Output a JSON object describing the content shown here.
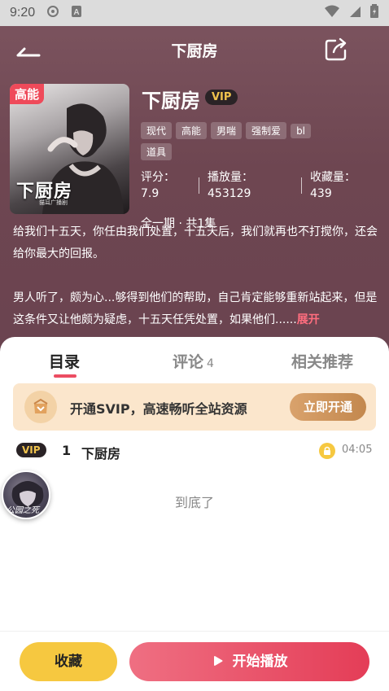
{
  "status_bar": {
    "time": "9:20"
  },
  "header": {
    "title": "下厨房"
  },
  "book": {
    "cover_badge": "高能",
    "cover_title": "下厨房",
    "cover_subtitle": "猫耳广播剧",
    "title": "下厨房",
    "vip_label": "VIP",
    "tags": [
      "现代",
      "高能",
      "男喘",
      "强制爱",
      "bl",
      "道具"
    ],
    "stats": {
      "rating_label": "评分：",
      "rating_value": "7.9",
      "plays_label": "播放量：",
      "plays_value": "453129",
      "favorites_label": "收藏量：",
      "favorites_value": "439"
    },
    "episodes_info": "全一期 · 共1集",
    "description": {
      "p1": "给我们十五天，你任由我们处置，十五天后，我们就再也不打搅你，还会给你最大的回报。",
      "p2": "男人听了，颇为心...够得到他们的帮助，自己肯定能够重新站起来，但是这条件又让他颇为疑虑，十五天任凭处置，如果他们......",
      "expand_label": "展开"
    }
  },
  "tabs": [
    {
      "label": "目录",
      "active": true
    },
    {
      "label": "评论",
      "count": "4"
    },
    {
      "label": "相关推荐"
    }
  ],
  "svip_banner": {
    "text": "开通SVIP，高速畅听全站资源",
    "button_label": "立即开通"
  },
  "episode_list": [
    {
      "vip_label": "VIP",
      "number": "1",
      "title": "下厨房",
      "duration": "04:05",
      "locked": true
    }
  ],
  "end_text": "到底了",
  "floating_avatar": {
    "text": "公园之死"
  },
  "bottom_bar": {
    "favorite_label": "收藏",
    "play_label": "开始播放"
  },
  "colors": {
    "accent": "#ec4d62",
    "vip_gold": "#f0c34d",
    "favorite_yellow": "#f6c840",
    "svip_banner_bg": "#fbe6cc"
  }
}
